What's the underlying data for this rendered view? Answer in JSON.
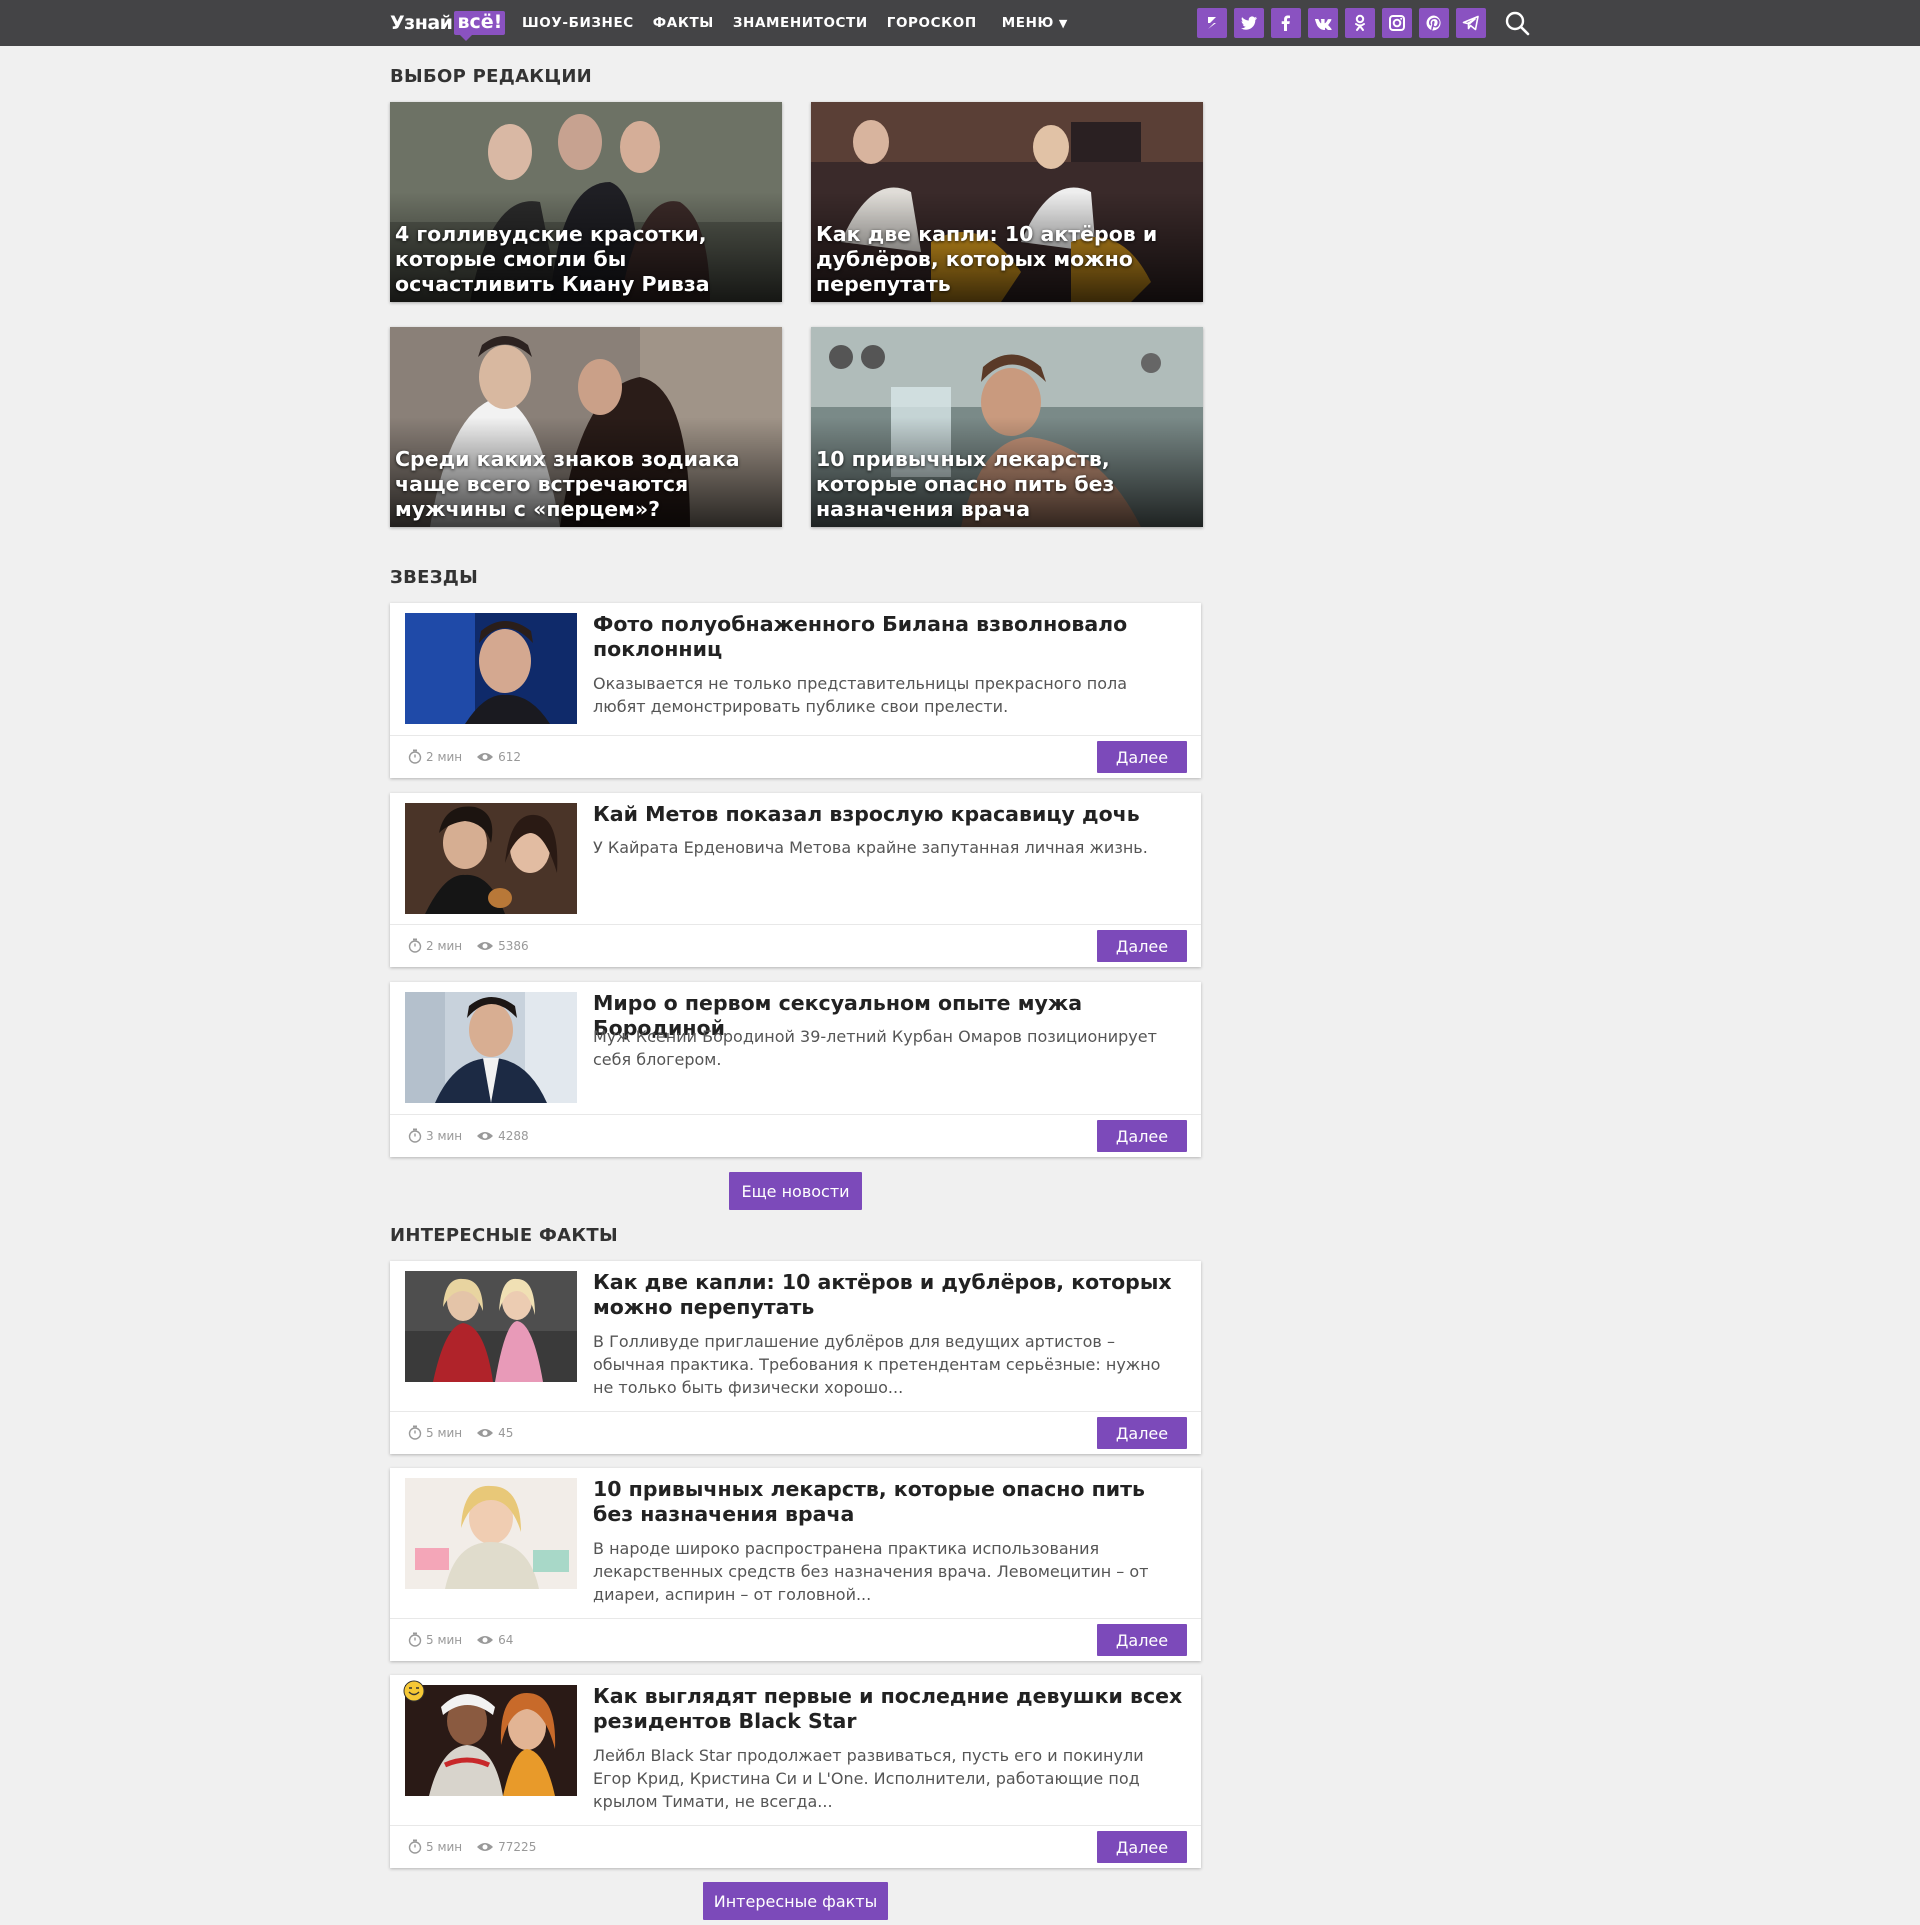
{
  "header": {
    "logo_a": "Узнай",
    "logo_b": "всё!",
    "nav": [
      "ШОУ-БИЗНЕС",
      "ФАКТЫ",
      "ЗНАМЕНИТОСТИ",
      "ГОРОСКОП"
    ],
    "menu_label": "МЕНЮ",
    "menu_caret": "▼",
    "socials": [
      "zen",
      "twitter",
      "facebook",
      "vk",
      "odnoklassniki",
      "instagram",
      "pinterest",
      "telegram"
    ],
    "accent": "#8a52c1"
  },
  "editors_choice": {
    "title": "ВЫБОР РЕДАКЦИИ",
    "tiles": [
      {
        "title": "4 голливудские красотки, которые смогли бы осчастливить Киану Ривза"
      },
      {
        "title": "Как две капли: 10 актёров и дублёров, которых можно перепутать"
      },
      {
        "title": "Среди каких знаков зодиака чаще всего встречаются мужчины с «перцем»?"
      },
      {
        "title": "10 привычных лекарств, которые опасно пить без назначения врача"
      }
    ]
  },
  "stars": {
    "title": "ЗВЕЗДЫ",
    "items": [
      {
        "title": "Фото полуобнаженного Билана взволновало поклонниц",
        "desc": "Оказывается не только представительницы прекрасного пола любят демонстрировать публике свои прелести.",
        "time": "2 мин",
        "views": "612",
        "button": "Далее"
      },
      {
        "title": "Кай Метов показал взрослую красавицу дочь",
        "desc": "У Кайрата Ерденовича Метова крайне запутанная личная жизнь.",
        "time": "2 мин",
        "views": "5386",
        "button": "Далее"
      },
      {
        "title": "Миро о первом сексуальном опыте мужа Бородиной",
        "desc": "Муж Ксении Бородиной 39-летний Курбан Омаров позиционирует себя блогером.",
        "time": "3 мин",
        "views": "4288",
        "button": "Далее"
      }
    ],
    "more_button": "Еще новости"
  },
  "facts": {
    "title": "ИНТЕРЕСНЫЕ ФАКТЫ",
    "items": [
      {
        "title": "Как две капли: 10 актёров и дублёров, которых можно перепутать",
        "desc": "В Голливуде приглашение дублёров для ведущих артистов – обычная практика. Требования к претендентам серьёзные: нужно не только быть физически хорошо...",
        "time": "5 мин",
        "views": "45",
        "button": "Далее"
      },
      {
        "title": "10 привычных лекарств, которые опасно пить без назначения врача",
        "desc": "В народе широко распространена практика использования лекарственных средств без назначения врача. Левомецитин – от диареи, аспирин – от головной...",
        "time": "5 мин",
        "views": "64",
        "button": "Далее"
      },
      {
        "title": "Как выглядят первые и последние девушки всех резидентов Black Star",
        "desc": "Лейбл Black Star продолжает развиваться, пусть его и покинули Егор Крид, Кристина Си и L'One. Исполнители, работающие под крылом Тимати, не всегда...",
        "time": "5 мин",
        "views": "77225",
        "button": "Далее"
      }
    ],
    "more_button": "Интересные факты"
  }
}
